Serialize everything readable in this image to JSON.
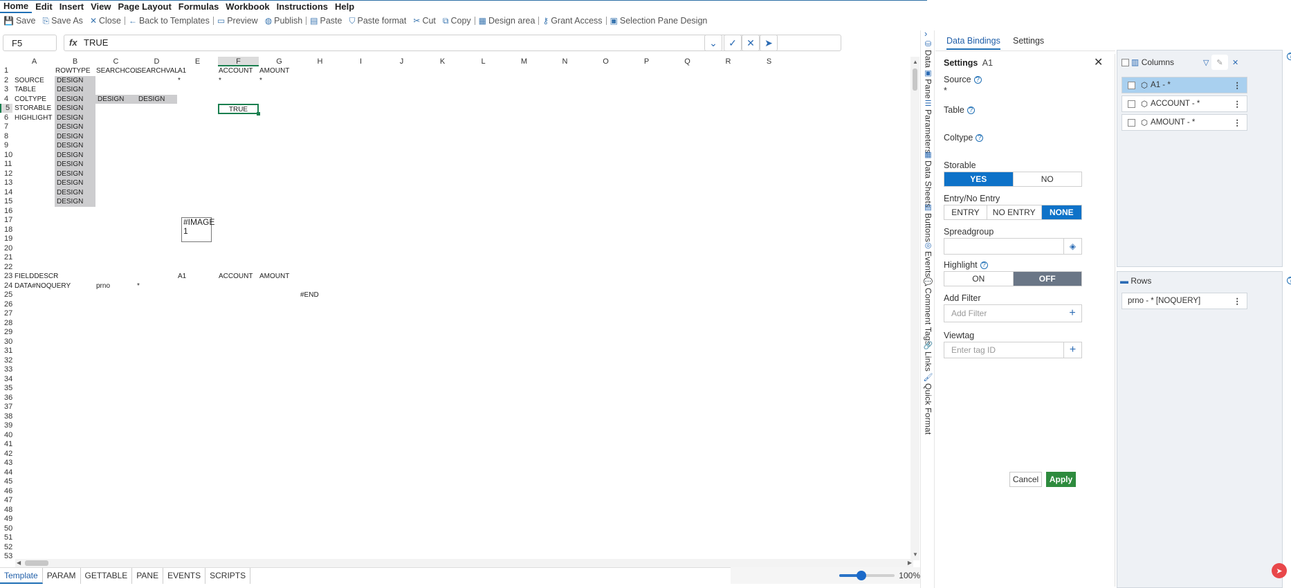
{
  "menu": [
    "Home",
    "Edit",
    "Insert",
    "View",
    "Page Layout",
    "Formulas",
    "Workbook",
    "Instructions",
    "Help"
  ],
  "toolbar": [
    {
      "icon": "save-icon",
      "glyph": "💾",
      "label": "Save"
    },
    {
      "icon": "save-as-icon",
      "glyph": "⎘",
      "label": "Save As"
    },
    {
      "icon": "close-icon",
      "glyph": "✕",
      "label": "Close"
    },
    {
      "icon": "back-arrow-icon",
      "glyph": "←",
      "label": "Back to Templates"
    },
    {
      "icon": "preview-icon",
      "glyph": "▭",
      "label": "Preview"
    },
    {
      "icon": "globe-icon",
      "glyph": "◍",
      "label": "Publish"
    },
    {
      "icon": "paste-icon",
      "glyph": "▤",
      "label": "Paste"
    },
    {
      "icon": "paste-format-icon",
      "glyph": "⛉",
      "label": "Paste format"
    },
    {
      "icon": "cut-icon",
      "glyph": "✂",
      "label": "Cut"
    },
    {
      "icon": "copy-icon",
      "glyph": "⧉",
      "label": "Copy"
    },
    {
      "icon": "design-area-icon",
      "glyph": "▦",
      "label": "Design area"
    },
    {
      "icon": "key-icon",
      "glyph": "⚷",
      "label": "Grant Access"
    },
    {
      "icon": "selection-pane-icon",
      "glyph": "▣",
      "label": "Selection Pane Design"
    }
  ],
  "formula": {
    "cell_ref": "F5",
    "fx": "fx",
    "value": "TRUE"
  },
  "columns": [
    "A",
    "B",
    "C",
    "D",
    "E",
    "F",
    "G",
    "H",
    "I",
    "J",
    "K",
    "L",
    "M",
    "N",
    "O",
    "P",
    "Q",
    "R",
    "S"
  ],
  "selected_column": "F",
  "selected_row": 5,
  "row_count": 54,
  "cells": [
    {
      "r": 1,
      "c": 1,
      "v": "ROWTYPE"
    },
    {
      "r": 1,
      "c": 2,
      "v": "SEARCHCOL"
    },
    {
      "r": 1,
      "c": 3,
      "v": "SEARCHVAL"
    },
    {
      "r": 1,
      "c": 4,
      "v": "A1"
    },
    {
      "r": 1,
      "c": 5,
      "v": "ACCOUNT"
    },
    {
      "r": 1,
      "c": 6,
      "v": "AMOUNT"
    },
    {
      "r": 2,
      "c": 0,
      "v": "SOURCE"
    },
    {
      "r": 2,
      "c": 1,
      "v": "DESIGN",
      "d": true
    },
    {
      "r": 2,
      "c": 4,
      "v": "*"
    },
    {
      "r": 2,
      "c": 5,
      "v": "*"
    },
    {
      "r": 2,
      "c": 6,
      "v": "*"
    },
    {
      "r": 3,
      "c": 0,
      "v": "TABLE"
    },
    {
      "r": 3,
      "c": 1,
      "v": "DESIGN",
      "d": true
    },
    {
      "r": 4,
      "c": 0,
      "v": "COLTYPE"
    },
    {
      "r": 4,
      "c": 1,
      "v": "DESIGN",
      "d": true
    },
    {
      "r": 4,
      "c": 2,
      "v": "DESIGN",
      "d": true
    },
    {
      "r": 4,
      "c": 3,
      "v": "DESIGN",
      "d": true
    },
    {
      "r": 5,
      "c": 0,
      "v": "STORABLE"
    },
    {
      "r": 5,
      "c": 1,
      "v": "DESIGN",
      "d": true
    },
    {
      "r": 6,
      "c": 0,
      "v": "HIGHLIGHT"
    },
    {
      "r": 6,
      "c": 1,
      "v": "DESIGN",
      "d": true
    },
    {
      "r": 7,
      "c": 1,
      "v": "DESIGN",
      "d": true
    },
    {
      "r": 8,
      "c": 1,
      "v": "DESIGN",
      "d": true
    },
    {
      "r": 9,
      "c": 1,
      "v": "DESIGN",
      "d": true
    },
    {
      "r": 10,
      "c": 1,
      "v": "DESIGN",
      "d": true
    },
    {
      "r": 11,
      "c": 1,
      "v": "DESIGN",
      "d": true
    },
    {
      "r": 12,
      "c": 1,
      "v": "DESIGN",
      "d": true
    },
    {
      "r": 13,
      "c": 1,
      "v": "DESIGN",
      "d": true
    },
    {
      "r": 14,
      "c": 1,
      "v": "DESIGN",
      "d": true
    },
    {
      "r": 15,
      "c": 1,
      "v": "DESIGN",
      "d": true
    },
    {
      "r": 23,
      "c": 0,
      "v": "FIELDDESCR"
    },
    {
      "r": 23,
      "c": 4,
      "v": "A1"
    },
    {
      "r": 23,
      "c": 5,
      "v": "ACCOUNT"
    },
    {
      "r": 23,
      "c": 6,
      "v": "AMOUNT"
    },
    {
      "r": 24,
      "c": 0,
      "v": "DATA#NOQUERY"
    },
    {
      "r": 24,
      "c": 2,
      "v": "prno"
    },
    {
      "r": 24,
      "c": 3,
      "v": "*"
    },
    {
      "r": 25,
      "c": 7,
      "v": "#END"
    }
  ],
  "selected_cell_value": "TRUE",
  "image_placeholder": {
    "line1": "#IMAGE",
    "line2": "1"
  },
  "sheet_tabs": [
    "Template",
    "PARAM",
    "GETTABLE",
    "PANE",
    "EVENTS",
    "SCRIPTS"
  ],
  "active_sheet": "Template",
  "zoom": {
    "label": "100%",
    "level": 0.4
  },
  "side_tabs": [
    {
      "icon": "data-icon",
      "glyph": "⛁",
      "label": "Data"
    },
    {
      "icon": "pane-icon",
      "glyph": "▣",
      "label": "Pane"
    },
    {
      "icon": "parameters-icon",
      "glyph": "☰",
      "label": "Parameters"
    },
    {
      "icon": "data-sheets-icon",
      "glyph": "▦",
      "label": "Data Sheets"
    },
    {
      "icon": "buttons-icon",
      "glyph": "▤",
      "label": "Buttons"
    },
    {
      "icon": "events-icon",
      "glyph": "◎",
      "label": "Events"
    },
    {
      "icon": "comment-tags-icon",
      "glyph": "💬",
      "label": "Comment Tags"
    },
    {
      "icon": "links-icon",
      "glyph": "🔗",
      "label": "Links"
    },
    {
      "icon": "quick-format-icon",
      "glyph": "🖌",
      "label": "Quick Format"
    }
  ],
  "panel_tabs": [
    "Data Bindings",
    "Settings"
  ],
  "settings": {
    "title": "Settings",
    "cell": "A1",
    "source_label": "Source",
    "source_value": "*",
    "table_label": "Table",
    "coltype_label": "Coltype",
    "storable_label": "Storable",
    "storable_options": [
      "YES",
      "NO"
    ],
    "entry_label": "Entry/No Entry",
    "entry_options": [
      "ENTRY",
      "NO ENTRY",
      "NONE"
    ],
    "spreadgroup_label": "Spreadgroup",
    "highlight_label": "Highlight",
    "highlight_options": [
      "ON",
      "OFF"
    ],
    "add_filter_label": "Add Filter",
    "add_filter_placeholder": "Add Filter",
    "viewtag_label": "Viewtag",
    "viewtag_placeholder": "Enter tag ID",
    "cancel": "Cancel",
    "apply": "Apply"
  },
  "columns_panel": {
    "title": "Columns",
    "items": [
      "A1 - *",
      "ACCOUNT - *",
      "AMOUNT - *"
    ],
    "selected_index": 0
  },
  "rows_panel": {
    "title": "Rows",
    "items": [
      "prno - * [NOQUERY]"
    ]
  },
  "colors": {
    "accent": "#0e72c8",
    "apply": "#2e8b3e",
    "design_fill": "#cdcdcf",
    "selection": "#1a7f4f"
  }
}
